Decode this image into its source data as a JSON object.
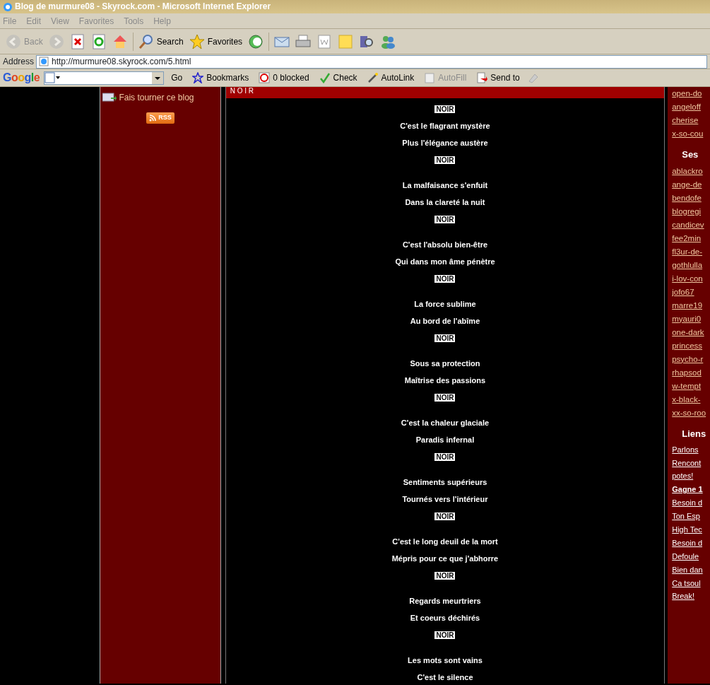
{
  "window": {
    "title": "Blog de murmure08 - Skyrock.com - Microsoft Internet Explorer"
  },
  "menu": [
    "File",
    "Edit",
    "View",
    "Favorites",
    "Tools",
    "Help"
  ],
  "toolbar": [
    {
      "kind": "back",
      "label": "Back",
      "disabled": true
    },
    {
      "kind": "forward",
      "disabled": true
    },
    {
      "kind": "stop"
    },
    {
      "kind": "refresh"
    },
    {
      "kind": "home"
    },
    {
      "kind": "search",
      "label": "Search"
    },
    {
      "kind": "favorites",
      "label": "Favorites"
    },
    {
      "kind": "history"
    },
    {
      "kind": "mail"
    },
    {
      "kind": "print"
    },
    {
      "kind": "word"
    },
    {
      "kind": "note"
    },
    {
      "kind": "research"
    },
    {
      "kind": "messenger"
    }
  ],
  "address": {
    "label": "Address",
    "value": "http://murmure08.skyrock.com/5.html"
  },
  "google_bar": {
    "logo": "Google",
    "go": "Go",
    "items": [
      {
        "kind": "bookmarks",
        "label": "Bookmarks",
        "disabled": false
      },
      {
        "kind": "blocked",
        "label": "0 blocked",
        "disabled": false
      },
      {
        "kind": "check",
        "label": "Check",
        "disabled": false
      },
      {
        "kind": "autolink",
        "label": "AutoLink",
        "disabled": false
      },
      {
        "kind": "autofill",
        "label": "AutoFill",
        "disabled": true
      },
      {
        "kind": "sendto",
        "label": "Send to",
        "disabled": false
      }
    ]
  },
  "sidebar": {
    "share_link": "Fais tourner ce blog",
    "rss": "RSS"
  },
  "post": {
    "header": "N O I R",
    "entries": [
      {
        "kind": "refrain",
        "text": "NOIR"
      },
      {
        "kind": "line",
        "text": "C'est le flagrant mystère"
      },
      {
        "kind": "line",
        "text": "Plus l'élégance austère"
      },
      {
        "kind": "refrain",
        "text": "NOIR"
      },
      {
        "kind": "line",
        "text": "La malfaisance s'enfuit"
      },
      {
        "kind": "line",
        "text": "Dans la clareté la nuit"
      },
      {
        "kind": "refrain",
        "text": "NOIR"
      },
      {
        "kind": "line",
        "text": "C'est l'absolu bien-être"
      },
      {
        "kind": "line",
        "text": "Qui dans mon âme pénètre"
      },
      {
        "kind": "refrain",
        "text": "NOIR"
      },
      {
        "kind": "line",
        "text": "La force sublime"
      },
      {
        "kind": "line",
        "text": "Au bord de l'abîme"
      },
      {
        "kind": "refrain",
        "text": "NOIR"
      },
      {
        "kind": "line",
        "text": "Sous sa protection"
      },
      {
        "kind": "line",
        "text": "Maîtrise des passions"
      },
      {
        "kind": "refrain",
        "text": "NOIR"
      },
      {
        "kind": "line",
        "text": "C'est la chaleur glaciale"
      },
      {
        "kind": "line",
        "text": "Paradis infernal"
      },
      {
        "kind": "refrain",
        "text": "NOIR"
      },
      {
        "kind": "line",
        "text": "Sentiments supérieurs"
      },
      {
        "kind": "line",
        "text": "Tournés vers l'intérieur"
      },
      {
        "kind": "refrain",
        "text": "NOIR"
      },
      {
        "kind": "line",
        "text": "C'est le long deuil de la mort"
      },
      {
        "kind": "line",
        "text": "Mépris pour ce que j'abhorre"
      },
      {
        "kind": "refrain",
        "text": "NOIR"
      },
      {
        "kind": "line",
        "text": "Regards meurtriers"
      },
      {
        "kind": "line",
        "text": "Et coeurs déchirés"
      },
      {
        "kind": "refrain",
        "text": "NOIR"
      },
      {
        "kind": "line",
        "text": "Les mots sont vains"
      },
      {
        "kind": "line",
        "text": "C'est le silence"
      }
    ]
  },
  "right_column": {
    "top_links": [
      "open-do",
      "angeloff",
      "cherise",
      "x-so-cou"
    ],
    "friends_heading": "Ses",
    "friends": [
      "ablackro",
      "ange-de",
      "bendofe",
      "blogregi",
      "candicev",
      "fee2min",
      "fl3ur-de-",
      "gothlulla",
      "i-lov-con",
      "jofo67",
      "marre19",
      "myauri0",
      "one-dark",
      "princess",
      "psycho-r",
      "rhapsod",
      "w-tempt",
      "x-black-",
      "xx-so-roo"
    ],
    "links_heading": "Liens",
    "links": [
      {
        "text": "Parlons",
        "bold": false
      },
      {
        "text": "Rencont potes!",
        "bold": false
      },
      {
        "text": "Gagne 1",
        "bold": true
      },
      {
        "text": "Besoin d",
        "bold": false
      },
      {
        "text": "Ton Esp",
        "bold": false
      },
      {
        "text": "High Tec",
        "bold": false
      },
      {
        "text": "Besoin d",
        "bold": false
      },
      {
        "text": "Defoule",
        "bold": false
      },
      {
        "text": "Bien dan",
        "bold": false
      },
      {
        "text": "Ca tsoul Break!",
        "bold": false
      }
    ]
  }
}
